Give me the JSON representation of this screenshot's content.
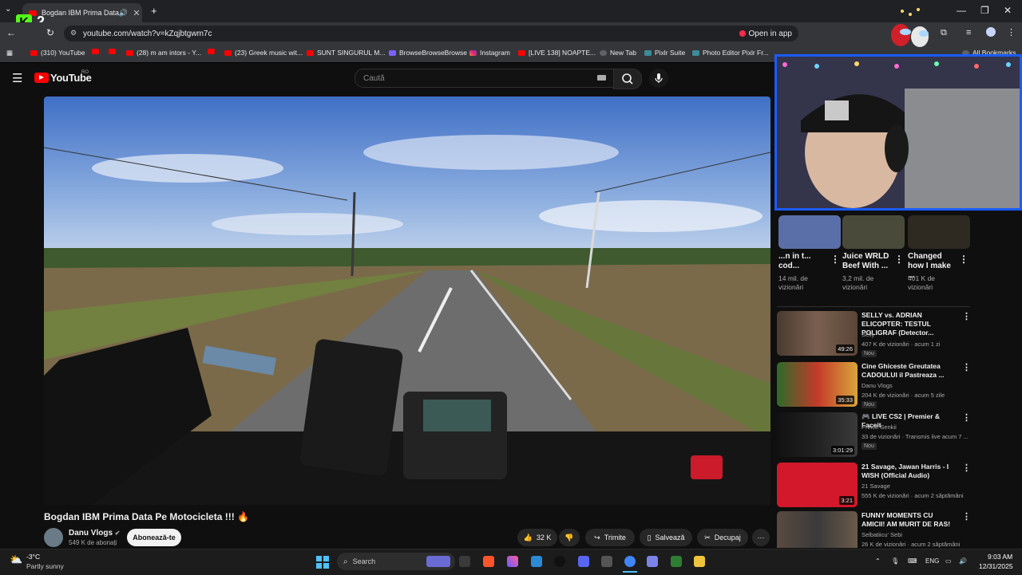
{
  "browser": {
    "tab_title": "Bogdan IBM Prima Data Pe",
    "url": "youtube.com/watch?v=kZqjbtgwm7c",
    "open_in_app": "Open in app",
    "overlay_badge": "2",
    "bookmarks": [
      "(310) YouTube",
      "(28) m am intors - Y...",
      "(23) Greek music wit...",
      "SUNT SINGURUL M...",
      "BrowseBrowseBrowse",
      "Instagram",
      "[LIVE 138] NOAPTE...",
      "New Tab",
      "Pixlr Suite",
      "Photo Editor Pixlr Fr...",
      "All Bookmarks"
    ]
  },
  "youtube": {
    "logo": "YouTube",
    "region": "RO",
    "search_placeholder": "Caută"
  },
  "video": {
    "title": "Bogdan IBM Prima Data Pe Motocicleta !!!",
    "title_emoji": "🔥",
    "channel": "Danu Vlogs",
    "subscribers": "549 K de abonați",
    "subscribe": "Abonează-te",
    "likes": "32 K",
    "share": "Trimite",
    "save": "Salvează",
    "clip": "Decupaj"
  },
  "shorts": [
    {
      "title": "...n in t... cod...",
      "views": "14 mil. de vizionări"
    },
    {
      "title": "Juice WRLD Beef With ...",
      "views": "3,2 mil. de vizionări"
    },
    {
      "title": "Changed how I make ...",
      "views": "401 K de vizionări"
    }
  ],
  "recommendations": [
    {
      "title": "SELLY vs. ADRIAN ELICOPTER: TESTUL POLIGRAF (Detector...",
      "channel": "Selly",
      "meta": "407 K de vizionări · acum 1 zi",
      "badge": "Nou",
      "duration": "49:26"
    },
    {
      "title": "Cine Ghiceste Greutatea CADOULUI il Pastreaza ...",
      "channel": "Danu Vlogs",
      "meta": "204 K de vizionări · acum 5 zile",
      "badge": "Nou",
      "duration": "35:33"
    },
    {
      "title": "LIVE CS2 | Premier & Faceit",
      "channel": "Prince Senkii",
      "meta": "33 de vizionări · Transmis live acum 7 ...",
      "badge": "Nou",
      "duration": "3:01:29"
    },
    {
      "title": "21 Savage, Jawan Harris - I WISH (Official Audio)",
      "channel": "21 Savage",
      "meta": "555 K de vizionări · acum 2 săptămâni",
      "badge": "",
      "duration": "3:21"
    },
    {
      "title": "FUNNY MOMENTS CU AMICII! AM MURIT DE RAS!",
      "channel": "Selbatiicu' Sebi",
      "meta": "26 K de vizionări · acum 2 săptămâni",
      "badge": "",
      "duration": ""
    }
  ],
  "taskbar": {
    "weather_temp": "-3°C",
    "weather_desc": "Partly sunny",
    "search": "Search",
    "lang": "ENG",
    "time": "9:03 AM",
    "date": "12/31/2025"
  },
  "colors": {
    "youtube_red": "#ff0000",
    "webcam_border": "#1a5cff"
  }
}
